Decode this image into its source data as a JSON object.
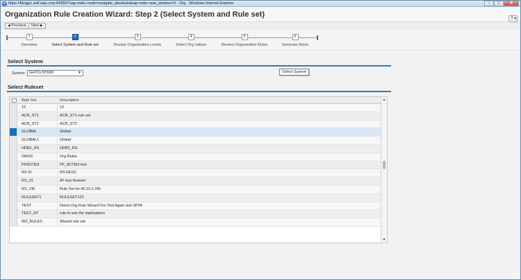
{
  "window": {
    "title": "https://fdcigp1.wdf.sap.corp:44355/?sap-nwbc-node=navigate_absolute&sap-nwbc-new_window=X - Org - Windows Internet Explorer",
    "min": "–",
    "max": "□",
    "close": "X"
  },
  "header": {
    "title": "Organization Rule Creation Wizard: Step 2  (Select System and Rule set)",
    "help": "?"
  },
  "nav": {
    "previous": "Previous",
    "next": "Next"
  },
  "roadmap": {
    "steps": [
      {
        "num": "1",
        "label": "Overview"
      },
      {
        "num": "2",
        "label": "Select System and Rule set"
      },
      {
        "num": "3",
        "label": "Review Organization Levels"
      },
      {
        "num": "4",
        "label": "Select Org Values"
      },
      {
        "num": "5",
        "label": "Review Organization Rules"
      },
      {
        "num": "6",
        "label": "Generate Rules"
      }
    ],
    "active_step": 2
  },
  "select_system": {
    "title": "Select System",
    "label": "System:",
    "value": "GH7CLNT600",
    "tooltip": "Select System"
  },
  "ruleset": {
    "title": "Select Ruleset",
    "columns": [
      "Rule Set",
      "Description"
    ],
    "rows": [
      {
        "rule": "12",
        "desc": "12"
      },
      {
        "rule": "ACR_ST1",
        "desc": "ACR_ST1  rule set"
      },
      {
        "rule": "ACR_ST2",
        "desc": "ACR_ST2"
      },
      {
        "rule": "GLOBAL",
        "desc": "Global"
      },
      {
        "rule": "GLOBAL1",
        "desc": "Global"
      },
      {
        "rule": "HDB2_RS",
        "desc": "HDB2_RS"
      },
      {
        "rule": "ORGS",
        "desc": "Org Rules"
      },
      {
        "rule": "PF827363",
        "desc": "PF_827363 test"
      },
      {
        "rule": "RS ID",
        "desc": "RS DESC"
      },
      {
        "rule": "RS_01",
        "desc": "AT test Ruleset"
      },
      {
        "rule": "RS_VIK",
        "desc": "Rule Set for AC10.1 VIK"
      },
      {
        "rule": "RULESET1",
        "desc": "RULESET123"
      },
      {
        "rule": "TEST",
        "desc": "Demo Org Rule Wizard For Test Again test SP04"
      },
      {
        "rule": "TEST_NT",
        "desc": "rule to see  the implications"
      },
      {
        "rule": "WZ_RULES",
        "desc": "Wizard rule set"
      }
    ],
    "selected_index": 3
  }
}
